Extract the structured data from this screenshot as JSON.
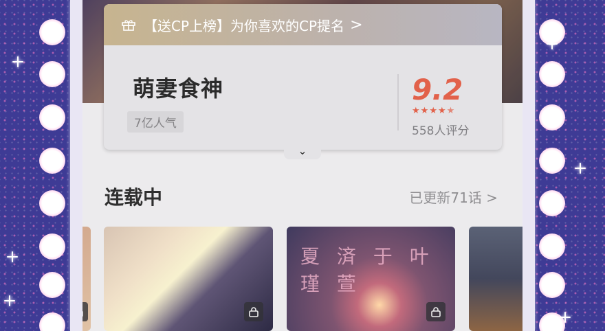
{
  "notice": {
    "text": "【送CP上榜】为你喜欢的CP提名",
    "arrow": ">"
  },
  "comic": {
    "title": "萌妻食神",
    "popularity": "7亿人气",
    "score": "9.2",
    "stars": [
      "★",
      "★",
      "★",
      "★",
      "★"
    ],
    "raters": "558人评分"
  },
  "expand_icon": "⌄",
  "serial": {
    "section_title": "连载中",
    "update_text": "已更新71话 >"
  },
  "thumbnails": [
    {
      "label": ""
    },
    {
      "label": ""
    },
    {
      "label": "",
      "overlay_text": "夏 済 于  叶 瑾 萱"
    },
    {
      "label": ""
    }
  ]
}
